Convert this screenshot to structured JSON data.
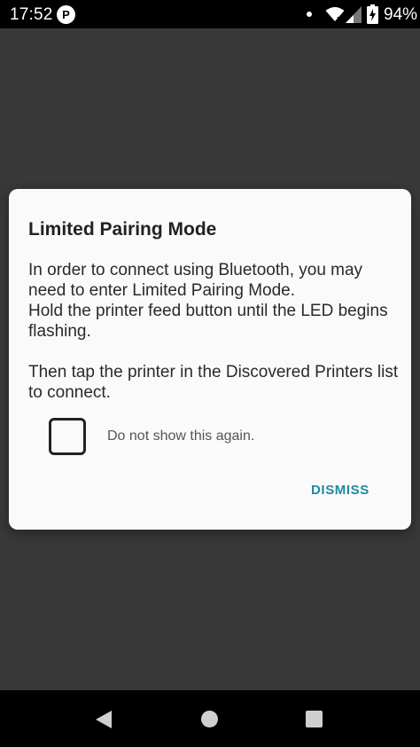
{
  "status_bar": {
    "time": "17:52",
    "app_icon": "pinterest-like-icon",
    "app_icon_glyph": "P",
    "battery": "94%"
  },
  "dialog": {
    "title": "Limited Pairing Mode",
    "message": "In order to connect using Bluetooth, you may need to enter Limited Pairing Mode.\nHold the printer feed button until the LED begins flashing.\n\nThen tap the printer in the Discovered Printers list to connect.",
    "checkbox_label": "Do not show this again.",
    "checkbox_checked": false,
    "dismiss_label": "DISMISS",
    "accent_color": "#1e8a9e"
  }
}
